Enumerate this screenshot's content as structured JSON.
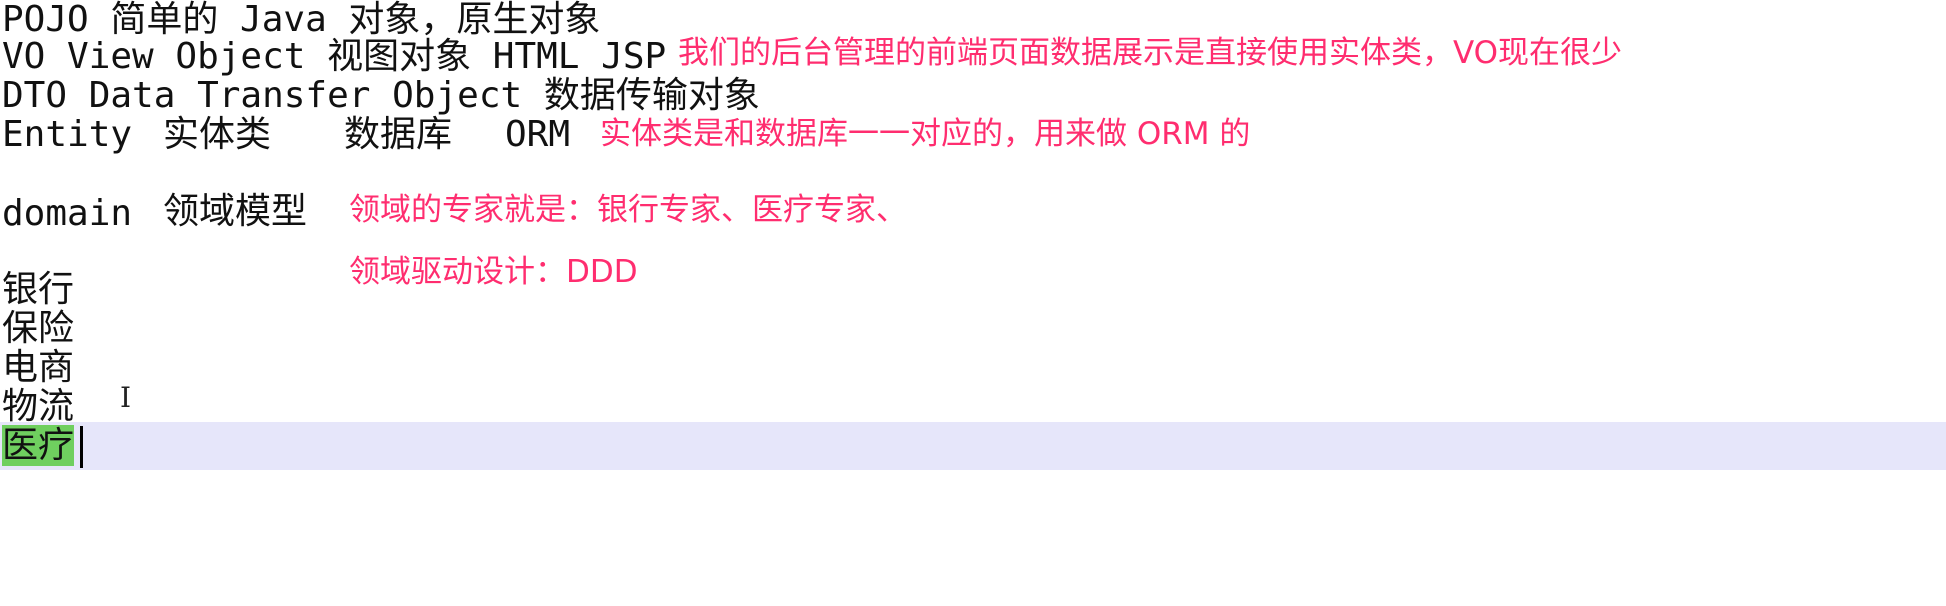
{
  "annotation_color": "#ff2d6f",
  "highlight_color": "#6fcf5f",
  "current_line_color": "#e6e6fa",
  "lines": {
    "pojo": {
      "code": "POJO 简单的 Java 对象，原生对象"
    },
    "vo": {
      "code": "VO View Object 视图对象  HTML JSP",
      "annotation": "我们的后台管理的前端页面数据展示是直接使用实体类，VO现在很少"
    },
    "dto": {
      "code": "DTO Data Transfer Object 数据传输对象"
    },
    "entity": {
      "term": "Entity",
      "cn": "实体类",
      "db": "数据库",
      "orm": "ORM",
      "annotation": "实体类是和数据库一一对应的，用来做 ORM 的"
    },
    "domain": {
      "term": "domain",
      "cn": "领域模型",
      "annotation": "领域的专家就是：银行专家、医疗专家、"
    },
    "ddd": {
      "annotation": "领域驱动设计：DDD"
    }
  },
  "industries": [
    "银行",
    "保险",
    "电商",
    "物流",
    "医疗"
  ],
  "cursor_icon": "text-cursor-icon"
}
